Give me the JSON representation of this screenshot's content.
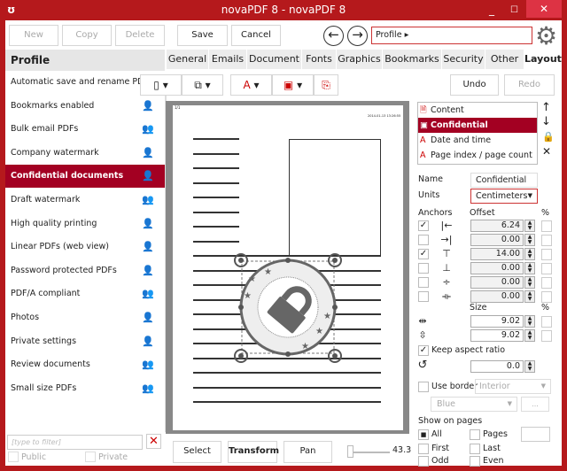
{
  "window": {
    "title": "novaPDF 8 - novaPDF 8",
    "minimize": "_",
    "maximize": "☐",
    "close": "✕"
  },
  "toolbar": {
    "new": "New",
    "copy": "Copy",
    "delete": "Delete",
    "save": "Save",
    "cancel": "Cancel",
    "back": "←",
    "forward": "→",
    "breadcrumb": "Profile",
    "breadcrumb_arrow": "▸"
  },
  "sidebar": {
    "header": "Profile",
    "items": [
      {
        "label": "Automatic save and rename PDFs",
        "icon": "user"
      },
      {
        "label": "Bookmarks enabled",
        "icon": "user"
      },
      {
        "label": "Bulk email PDFs",
        "icon": "users"
      },
      {
        "label": "Company watermark",
        "icon": "user"
      },
      {
        "label": "Confidential documents",
        "icon": "user",
        "selected": true
      },
      {
        "label": "Draft watermark",
        "icon": "users"
      },
      {
        "label": "High quality printing",
        "icon": "user"
      },
      {
        "label": "Linear PDFs (web view)",
        "icon": "user"
      },
      {
        "label": "Password protected PDFs",
        "icon": "user"
      },
      {
        "label": "PDF/A compliant",
        "icon": "users"
      },
      {
        "label": "Photos",
        "icon": "user"
      },
      {
        "label": "Private settings",
        "icon": "user"
      },
      {
        "label": "Review documents",
        "icon": "users"
      },
      {
        "label": "Small size PDFs",
        "icon": "users"
      }
    ],
    "filter_placeholder": "[type to filter]",
    "public": "Public",
    "private": "Private"
  },
  "tabs": [
    "General",
    "Emails",
    "Document",
    "Fonts",
    "Graphics",
    "Bookmarks",
    "Security",
    "Other",
    "Layout"
  ],
  "layout": {
    "undo": "Undo",
    "redo": "Redo",
    "page_preview": {
      "page_index": "1/1",
      "date": "2014-01-13 13:26:55"
    },
    "modes": {
      "select": "Select",
      "transform": "Transform",
      "pan": "Pan"
    },
    "zoom": "43.3",
    "zoom_fraction": 0.05,
    "content_list": [
      "Content",
      "Confidential",
      "Date and time",
      "Page index / page count"
    ],
    "name_label": "Name",
    "name_value": "Confidential",
    "units_label": "Units",
    "units_value": "Centimeters",
    "anchors_label": "Anchors",
    "offset_label": "Offset",
    "pct_label": "%",
    "offsets": [
      {
        "checked": true,
        "value": "6.24",
        "icon": "|←"
      },
      {
        "checked": false,
        "value": "0.00",
        "icon": "→|"
      },
      {
        "checked": true,
        "value": "14.00",
        "icon": "⊤"
      },
      {
        "checked": false,
        "value": "0.00",
        "icon": "⊥"
      },
      {
        "checked": false,
        "value": "0.00",
        "icon": "÷"
      },
      {
        "checked": false,
        "value": "0.00",
        "icon": "⟛"
      }
    ],
    "size_label": "Size",
    "sizes": [
      "9.02",
      "9.02"
    ],
    "keep_aspect": "Keep aspect ratio",
    "rotation": "0.0",
    "use_border": "Use border",
    "border_type": "Interior",
    "border_color": "Blue",
    "more": "...",
    "show_on_pages": "Show on pages",
    "all": "All",
    "pages": "Pages",
    "first": "First",
    "last": "Last",
    "odd": "Odd",
    "even": "Even"
  },
  "colors": {
    "brand": "#b5191c",
    "selected": "#a30022"
  }
}
